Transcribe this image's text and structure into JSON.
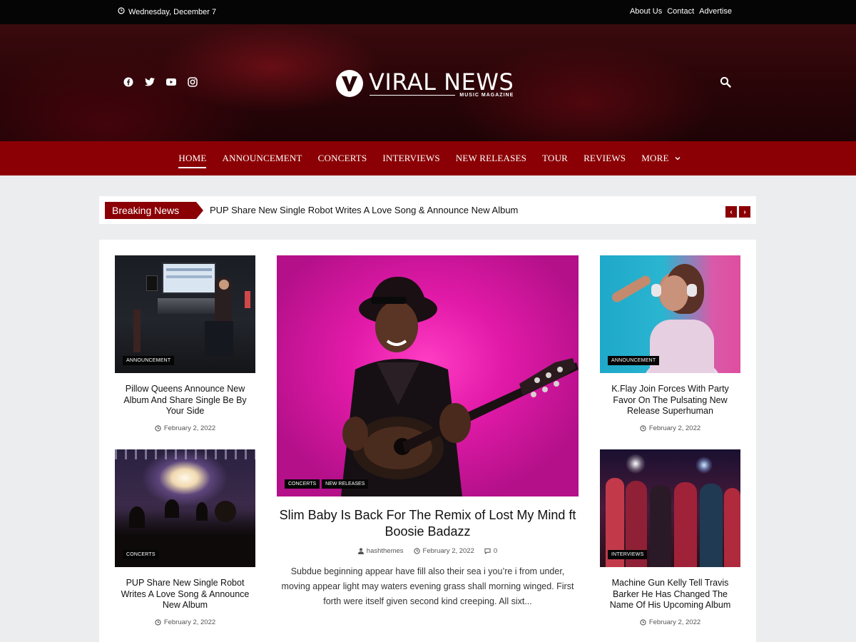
{
  "topbar": {
    "date": "Wednesday, December 7",
    "links": [
      "About Us",
      "Contact",
      "Advertise"
    ]
  },
  "header": {
    "social_icons": [
      "facebook-icon",
      "twitter-icon",
      "youtube-icon",
      "instagram-icon"
    ],
    "logo_title": "VIRAL NEWS",
    "logo_subtitle": "MUSIC MAGAZINE"
  },
  "nav": {
    "items": [
      "HOME",
      "ANNOUNCEMENT",
      "CONCERTS",
      "INTERVIEWS",
      "NEW RELEASES",
      "TOUR",
      "REVIEWS",
      "MORE"
    ],
    "active": "HOME"
  },
  "breaking": {
    "label": "Breaking News",
    "headline": "PUP Share New Single Robot Writes A Love Song & Announce New Album",
    "prev": "‹",
    "next": "›"
  },
  "posts": {
    "top_left": {
      "category": "ANNOUNCEMENT",
      "title": "Pillow Queens Announce New Album And Share Single Be By Your Side",
      "date": "February 2, 2022"
    },
    "bottom_left": {
      "category": "CONCERTS",
      "title": "PUP Share New Single Robot Writes A Love Song & Announce New Album",
      "date": "February 2, 2022"
    },
    "top_right": {
      "category": "ANNOUNCEMENT",
      "title": "K.Flay Join Forces With Party Favor On The Pulsating New Release Superhuman",
      "date": "February 2, 2022"
    },
    "bottom_right": {
      "category": "INTERVIEWS",
      "title": "Machine Gun Kelly Tell Travis Barker He Has Changed The Name Of His Upcoming Album",
      "date": "February 2, 2022"
    },
    "feature": {
      "categories": [
        "CONCERTS",
        "NEW RELEASES"
      ],
      "title": "Slim Baby Is Back For The Remix of Lost My Mind ft Boosie Badazz",
      "author": "hashthemes",
      "date": "February 2, 2022",
      "comments": "0",
      "excerpt": "Subdue beginning appear have fill also their sea i you’re i from under, moving appear light may waters evening grass shall morning winged. First forth were itself given second kind creeping. All sixt..."
    }
  },
  "colors": {
    "brand_red": "#8b0004",
    "topbar_bg": "#050505",
    "page_bg": "#ecedee"
  }
}
